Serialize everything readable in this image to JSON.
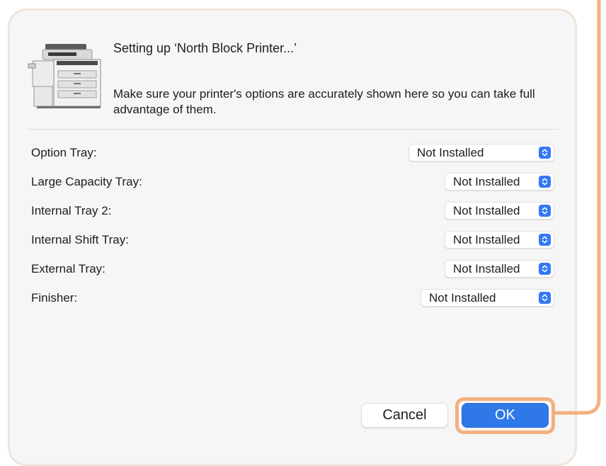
{
  "dialog": {
    "title": "Setting up ‘North Block Printer...’",
    "message": "Make sure your printer's options are accurately shown here so you can take full advantage of them.",
    "icon": "printer-icon"
  },
  "options": [
    {
      "label": "Option Tray:",
      "value": "Not Installed"
    },
    {
      "label": "Large Capacity Tray:",
      "value": "Not Installed"
    },
    {
      "label": "Internal Tray 2:",
      "value": "Not Installed"
    },
    {
      "label": "Internal Shift Tray:",
      "value": "Not Installed"
    },
    {
      "label": "External Tray:",
      "value": "Not Installed"
    },
    {
      "label": "Finisher:",
      "value": "Not Installed"
    }
  ],
  "buttons": {
    "cancel_label": "Cancel",
    "ok_label": "OK"
  },
  "colors": {
    "accent": "#2f78e8",
    "highlight": "#f3b07f",
    "dialog_background": "#f6f6f6"
  }
}
